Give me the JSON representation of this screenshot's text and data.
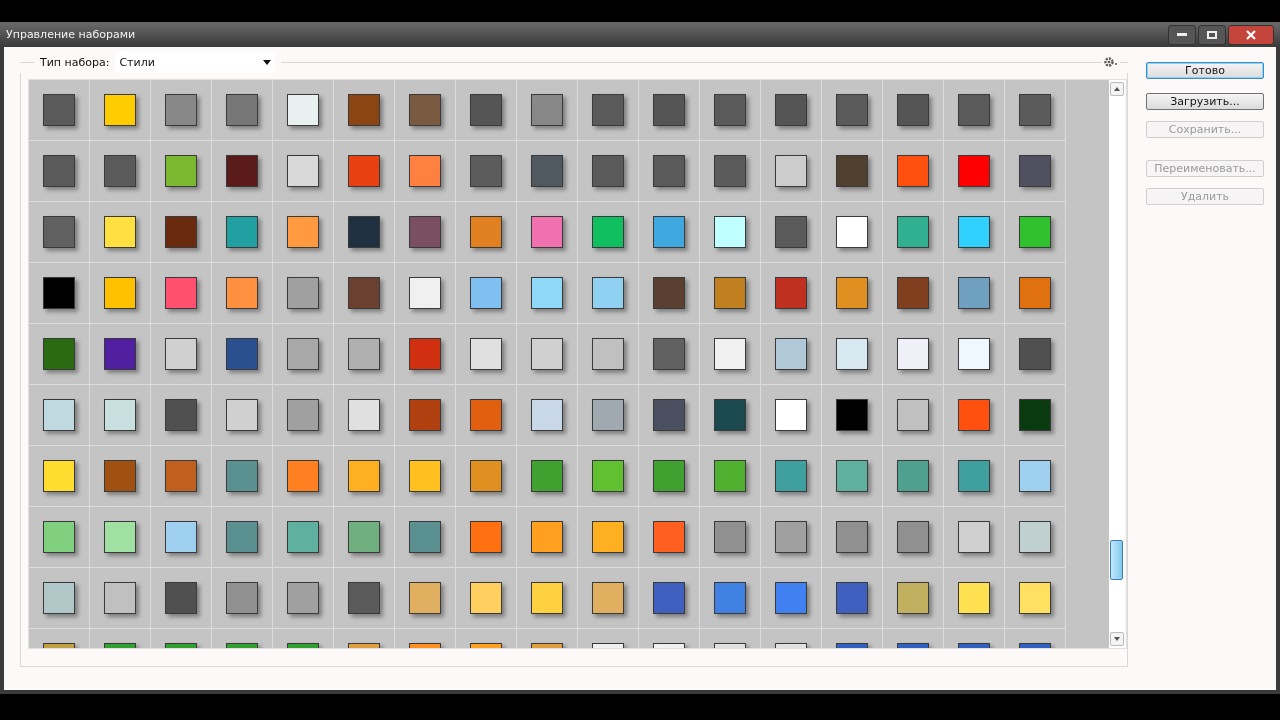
{
  "window": {
    "title": "Управление наборами"
  },
  "preset_type": {
    "label": "Тип набора:",
    "value": "Стили"
  },
  "swatch_rows": [
    {
      "swatches": [
        {
          "color": "#5a5a5a"
        },
        {
          "color": "#ffcc00"
        },
        {
          "color": "#888888"
        },
        {
          "color": "#777777"
        },
        {
          "color": "#e8f0f0"
        },
        {
          "color": "#8b4513"
        },
        {
          "color": "#7a5a40"
        },
        {
          "color": "#555555"
        },
        {
          "color": "#888888"
        },
        {
          "color": "#5a5a5a"
        },
        {
          "color": "#555555"
        },
        {
          "color": "#5a5a5a"
        },
        {
          "color": "#555555"
        },
        {
          "color": "#5a5a5a"
        },
        {
          "color": "#555555"
        },
        {
          "color": "#5a5a5a"
        },
        {
          "color": "#5b5b5b"
        }
      ]
    },
    {
      "swatches": [
        {
          "color": "#5a5a5a"
        },
        {
          "color": "#5b5b5b"
        },
        {
          "color": "#7ab830"
        },
        {
          "color": "#5a1a1a"
        },
        {
          "color": "#d8d8d8"
        },
        {
          "color": "#e84010"
        },
        {
          "color": "#ff8040"
        },
        {
          "color": "#5c5c5c"
        },
        {
          "color": "#505860"
        },
        {
          "color": "#5a5a5b"
        },
        {
          "color": "#5b5a5a"
        },
        {
          "color": "#5a5b5a"
        },
        {
          "color": "#cccccc"
        },
        {
          "color": "#504030"
        },
        {
          "color": "#ff5010"
        },
        {
          "color": "#ff0000"
        },
        {
          "color": "#505060"
        }
      ]
    },
    {
      "swatches": [
        {
          "color": "#606060"
        },
        {
          "color": "#ffe040"
        },
        {
          "color": "#6a2a10"
        },
        {
          "color": "#20a0a0"
        },
        {
          "color": "#ff9a40"
        },
        {
          "color": "#203040"
        },
        {
          "color": "#7a5060"
        },
        {
          "color": "#e08020"
        },
        {
          "color": "#f070b0"
        },
        {
          "color": "#10c060"
        },
        {
          "color": "#40a8e0"
        },
        {
          "color": "#c0ffff"
        },
        {
          "color": "#5a5a5a"
        },
        {
          "color": "#ffffff"
        },
        {
          "color": "#30b090"
        },
        {
          "color": "#30d0ff"
        },
        {
          "color": "#30c030"
        }
      ]
    },
    {
      "swatches": [
        {
          "color": "#000000"
        },
        {
          "color": "#ffc000"
        },
        {
          "color": "#ff5070"
        },
        {
          "color": "#ff9040"
        },
        {
          "color": "#a0a0a0"
        },
        {
          "color": "#6a4030"
        },
        {
          "color": "#f0f0f0"
        },
        {
          "color": "#80c0f0"
        },
        {
          "color": "#90d8f8"
        },
        {
          "color": "#90d0f0"
        },
        {
          "color": "#5a4030"
        },
        {
          "color": "#c08020"
        },
        {
          "color": "#c03020"
        },
        {
          "color": "#e09020"
        },
        {
          "color": "#804020"
        },
        {
          "color": "#70a0c0"
        },
        {
          "color": "#e07010"
        }
      ]
    },
    {
      "swatches": [
        {
          "color": "#2a6a10"
        },
        {
          "color": "#5020a0"
        },
        {
          "color": "#d0d0d0"
        },
        {
          "color": "#2a5090"
        },
        {
          "color": "#a8a8a8"
        },
        {
          "color": "#b0b0b0"
        },
        {
          "color": "#d03010"
        },
        {
          "color": "#e0e0e0"
        },
        {
          "color": "#d0d0d0"
        },
        {
          "color": "#c0c0c0"
        },
        {
          "color": "#606060"
        },
        {
          "color": "#f0f0f0"
        },
        {
          "color": "#b0c8d8"
        },
        {
          "color": "#d8e8f0"
        },
        {
          "color": "#f0f0f8"
        },
        {
          "color": "#f0f8ff"
        },
        {
          "color": "#505050"
        }
      ]
    },
    {
      "swatches": [
        {
          "color": "#c0d8e0"
        },
        {
          "color": "#c8e0e0"
        },
        {
          "color": "#505050"
        },
        {
          "color": "#d0d0d0"
        },
        {
          "color": "#a0a0a0"
        },
        {
          "color": "#e0e0e0"
        },
        {
          "color": "#b04010"
        },
        {
          "color": "#e06010"
        },
        {
          "color": "#c8d8e8"
        },
        {
          "color": "#a0a8b0"
        },
        {
          "color": "#4a5060"
        },
        {
          "color": "#1a4a50"
        },
        {
          "color": "#ffffff"
        },
        {
          "color": "#000000"
        },
        {
          "color": "#c0c0c0"
        },
        {
          "color": "#ff5010"
        },
        {
          "color": "#0a3a10"
        }
      ]
    },
    {
      "swatches": [
        {
          "color": "#ffdc30"
        },
        {
          "color": "#a05010"
        },
        {
          "color": "#c06020"
        },
        {
          "color": "#5a9090"
        },
        {
          "color": "#ff8020"
        },
        {
          "color": "#ffb020"
        },
        {
          "color": "#ffc020"
        },
        {
          "color": "#e09020"
        },
        {
          "color": "#40a030"
        },
        {
          "color": "#60c030"
        },
        {
          "color": "#40a030"
        },
        {
          "color": "#50b030"
        },
        {
          "color": "#40a0a0"
        },
        {
          "color": "#60b0a0"
        },
        {
          "color": "#50a090"
        },
        {
          "color": "#40a0a0"
        },
        {
          "color": "#a0d0f0"
        }
      ]
    },
    {
      "swatches": [
        {
          "color": "#80d080"
        },
        {
          "color": "#a0e0a0"
        },
        {
          "color": "#a0d0f0"
        },
        {
          "color": "#5a9090"
        },
        {
          "color": "#60b0a0"
        },
        {
          "color": "#70b080"
        },
        {
          "color": "#5a9090"
        },
        {
          "color": "#ff7010"
        },
        {
          "color": "#ffa020"
        },
        {
          "color": "#ffb020"
        },
        {
          "color": "#ff6020"
        },
        {
          "color": "#909090"
        },
        {
          "color": "#a0a0a0"
        },
        {
          "color": "#909090"
        },
        {
          "color": "#909090"
        },
        {
          "color": "#d0d0d0"
        },
        {
          "color": "#c0d0d0"
        }
      ]
    },
    {
      "swatches": [
        {
          "color": "#b0c8c8"
        },
        {
          "color": "#c0c0c0"
        },
        {
          "color": "#505050"
        },
        {
          "color": "#909090"
        },
        {
          "color": "#a0a0a0"
        },
        {
          "color": "#5a5a5a"
        },
        {
          "color": "#e0b060"
        },
        {
          "color": "#ffd060"
        },
        {
          "color": "#ffd040"
        },
        {
          "color": "#e0b060"
        },
        {
          "color": "#4060c0"
        },
        {
          "color": "#4080e0"
        },
        {
          "color": "#4080f0"
        },
        {
          "color": "#4060c0"
        },
        {
          "color": "#c0b060"
        },
        {
          "color": "#ffe050"
        },
        {
          "color": "#ffe060"
        }
      ]
    },
    {
      "swatches": [
        {
          "color": "#c0a040"
        },
        {
          "color": "#30a030"
        },
        {
          "color": "#30a030"
        },
        {
          "color": "#30a030"
        },
        {
          "color": "#30a030"
        },
        {
          "color": "#e0a040"
        },
        {
          "color": "#ff9020"
        },
        {
          "color": "#ffa020"
        },
        {
          "color": "#e0a040"
        },
        {
          "color": "#f0f0f0"
        },
        {
          "color": "#f0f0f0"
        },
        {
          "color": "#e0e0e0"
        },
        {
          "color": "#e0e0e0"
        },
        {
          "color": "#3060c0"
        },
        {
          "color": "#3060c0"
        },
        {
          "color": "#3060c0"
        },
        {
          "color": "#3060c0"
        }
      ]
    }
  ],
  "buttons": [
    {
      "label": "Готово",
      "disabled": false,
      "default": true
    },
    {
      "label": "Загрузить...",
      "disabled": false,
      "default": false
    },
    {
      "label": "Сохранить...",
      "disabled": true,
      "default": false
    },
    {
      "label": "Переименовать...",
      "disabled": true,
      "default": false
    },
    {
      "label": "Удалить",
      "disabled": true,
      "default": false
    }
  ]
}
